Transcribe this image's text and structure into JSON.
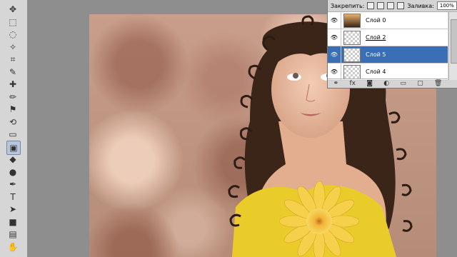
{
  "toolbar": {
    "tools": [
      {
        "icon": "move-icon",
        "glyph": "✥"
      },
      {
        "icon": "marquee-icon",
        "glyph": "⬚"
      },
      {
        "icon": "lasso-icon",
        "glyph": "◌"
      },
      {
        "icon": "magic-wand-icon",
        "glyph": "✧"
      },
      {
        "icon": "crop-icon",
        "glyph": "⌗"
      },
      {
        "icon": "eyedropper-icon",
        "glyph": "✎"
      },
      {
        "icon": "healing-brush-icon",
        "glyph": "✚"
      },
      {
        "icon": "brush-icon",
        "glyph": "✏"
      },
      {
        "icon": "clone-stamp-icon",
        "glyph": "⚑"
      },
      {
        "icon": "history-brush-icon",
        "glyph": "⟲"
      },
      {
        "icon": "eraser-icon",
        "glyph": "▭"
      },
      {
        "icon": "gradient-icon",
        "glyph": "▣"
      },
      {
        "icon": "blur-icon",
        "glyph": "◆"
      },
      {
        "icon": "dodge-icon",
        "glyph": "●"
      },
      {
        "icon": "pen-icon",
        "glyph": "✒"
      },
      {
        "icon": "type-icon",
        "glyph": "T"
      },
      {
        "icon": "path-selection-icon",
        "glyph": "➤"
      },
      {
        "icon": "shape-icon",
        "glyph": "■"
      },
      {
        "icon": "notes-icon",
        "glyph": "▤"
      },
      {
        "icon": "hand-icon",
        "glyph": "✋"
      }
    ],
    "active_tool": "gradient-icon"
  },
  "layers_panel": {
    "lock_label": "Закрепить:",
    "fill_label": "Заливка:",
    "fill_value": "100%",
    "layers": [
      {
        "name": "Слой 0",
        "selected": false,
        "underlined": false,
        "has_photo": true
      },
      {
        "name": "Слой 2",
        "selected": false,
        "underlined": true,
        "has_photo": false
      },
      {
        "name": "Слой 5",
        "selected": true,
        "underlined": false,
        "has_photo": false
      },
      {
        "name": "Слой 4",
        "selected": false,
        "underlined": false,
        "has_photo": false
      }
    ],
    "footer_icons": [
      "link-icon",
      "fx-icon",
      "mask-icon",
      "adjustment-icon",
      "group-icon",
      "new-layer-icon",
      "trash-icon"
    ],
    "footer_glyphs": [
      "⚭",
      "fx",
      "◙",
      "◐",
      "▭",
      "▢",
      "🗑"
    ]
  },
  "colors": {
    "selected_layer": "#3a6fb5",
    "canvas_base": "#c89f8b"
  }
}
